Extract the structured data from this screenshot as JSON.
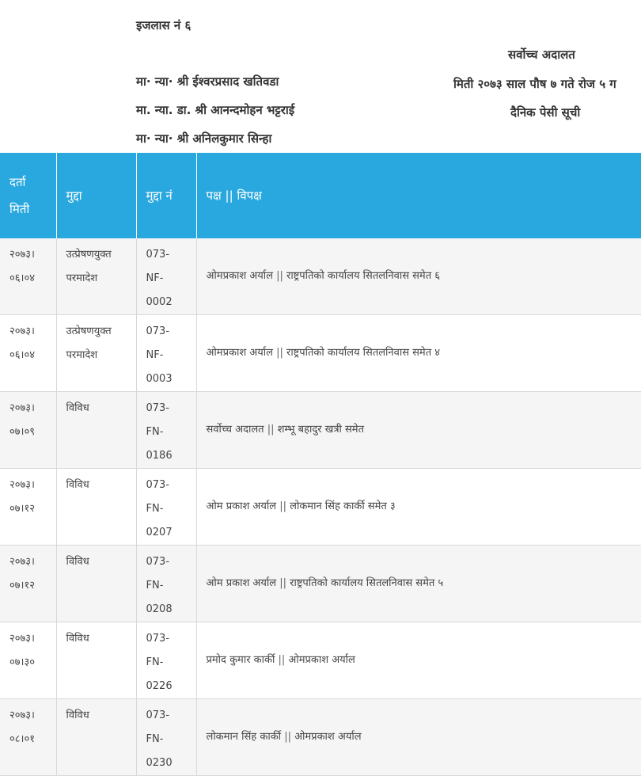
{
  "header": {
    "ijlas": "इजलास नं  ६",
    "judges": [
      "मा· न्या· श्री ईश्वरप्रसाद खतिवडा",
      "मा. न्या. डा. श्री आनन्दमोहन भट्टराई",
      "मा· न्या· श्री अनिलकुमार सिन्हा"
    ],
    "court": "सर्वोच्च अदालत",
    "date_line": "मिती २०७३ साल पौष ७ गते रोज ५ ग",
    "list_title": "दैनिक पेसी सूची"
  },
  "table": {
    "columns": {
      "date_line1": "दर्ता",
      "date_line2": "मिती",
      "subject": "मुद्दा",
      "case_no": "मुद्दा नं",
      "parties": "पक्ष || विपक्ष"
    },
    "rows": [
      {
        "date1": "२०७३।",
        "date2": "०६।०४",
        "subj1": "उत्प्रेषणयुक्त",
        "subj2": "परमादेश",
        "no1": "073-NF-",
        "no2": "0002",
        "party": "ओमप्रकाश अर्याल",
        "sep": "||",
        "opp": "राष्ट्रपतिको कार्यालय सितलनिवास समेत ६"
      },
      {
        "date1": "२०७३।",
        "date2": "०६।०४",
        "subj1": "उत्प्रेषणयुक्त",
        "subj2": "परमादेश",
        "no1": "073-NF-",
        "no2": "0003",
        "party": "ओमप्रकाश अर्याल",
        "sep": "||",
        "opp": "राष्ट्रपतिको कार्यालय सितलनिवास समेत ४"
      },
      {
        "date1": "२०७३।",
        "date2": "०७।०९",
        "subj1": "विविध",
        "subj2": "",
        "no1": "073-FN-",
        "no2": "0186",
        "party": "सर्वोच्च अदालत",
        "sep": "||",
        "opp": "शम्भू बहादुर खत्री समेत"
      },
      {
        "date1": "२०७३।",
        "date2": "०७।१२",
        "subj1": "विविध",
        "subj2": "",
        "no1": "073-FN-",
        "no2": "0207",
        "party": "ओम प्रकाश अर्याल",
        "sep": "||",
        "opp": "लोकमान सिंह कार्की समेत ३"
      },
      {
        "date1": "२०७३।",
        "date2": "०७।१२",
        "subj1": "विविध",
        "subj2": "",
        "no1": "073-FN-",
        "no2": "0208",
        "party": "ओम प्रकाश अर्याल",
        "sep": "||",
        "opp": "राष्ट्रपतिको कार्यालय सितलनिवास समेत ५"
      },
      {
        "date1": "२०७३।",
        "date2": "०७।३०",
        "subj1": "विविध",
        "subj2": "",
        "no1": "073-FN-",
        "no2": "0226",
        "party": "प्रमोद कुमार कार्की",
        "sep": "||",
        "opp": "ओमप्रकाश अर्याल"
      },
      {
        "date1": "२०७३।",
        "date2": "०८।०१",
        "subj1": "विविध",
        "subj2": "",
        "no1": "073-FN-",
        "no2": "0230",
        "party": "लोकमान सिंह कार्की",
        "sep": "||",
        "opp": "ओमप्रकाश अर्याल"
      }
    ]
  },
  "colors": {
    "header_bg": "#29a8df",
    "stripe": "#f5f5f5"
  }
}
